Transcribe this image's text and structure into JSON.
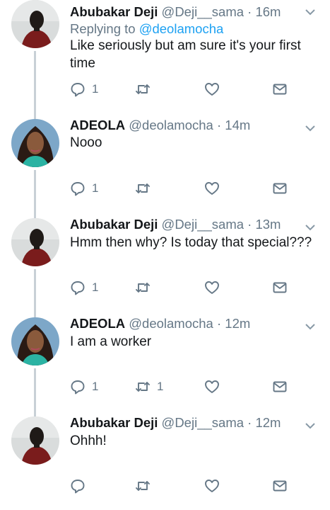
{
  "tweets": [
    {
      "name": "Abubakar Deji",
      "handle": "@Deji__sama",
      "separator": "·",
      "time": "16m",
      "reply_prefix": "Replying to",
      "reply_to": "@deolamocha",
      "text_line1": "Like seriously but am sure it's your first",
      "text_line2": "time",
      "reply_count": "1",
      "retweet_count": "",
      "avatar": "male"
    },
    {
      "name": "ADEOLA",
      "handle": "@deolamocha",
      "separator": "·",
      "time": "14m",
      "text_line1": "Nooo",
      "reply_count": "1",
      "retweet_count": "",
      "avatar": "female"
    },
    {
      "name": "Abubakar Deji",
      "handle": "@Deji__sama",
      "separator": "·",
      "time": "13m",
      "text_line1": "Hmm then why? Is today that special???",
      "reply_count": "1",
      "retweet_count": "",
      "avatar": "male"
    },
    {
      "name": "ADEOLA",
      "handle": "@deolamocha",
      "separator": "·",
      "time": "12m",
      "text_line1": "I am a worker",
      "reply_count": "1",
      "retweet_count": "1",
      "avatar": "female"
    },
    {
      "name": "Abubakar Deji",
      "handle": "@Deji__sama",
      "separator": "·",
      "time": "12m",
      "text_line1": "Ohhh!",
      "reply_count": "",
      "retweet_count": "",
      "avatar": "male"
    }
  ],
  "icons": {
    "reply": "reply-icon",
    "retweet": "retweet-icon",
    "like": "heart-icon",
    "dm": "envelope-icon",
    "caret": "chevron-down-icon"
  },
  "colors": {
    "name": "#14171a",
    "meta": "#657786",
    "link": "#1da1f2",
    "thread_line": "#c8d0d6"
  }
}
